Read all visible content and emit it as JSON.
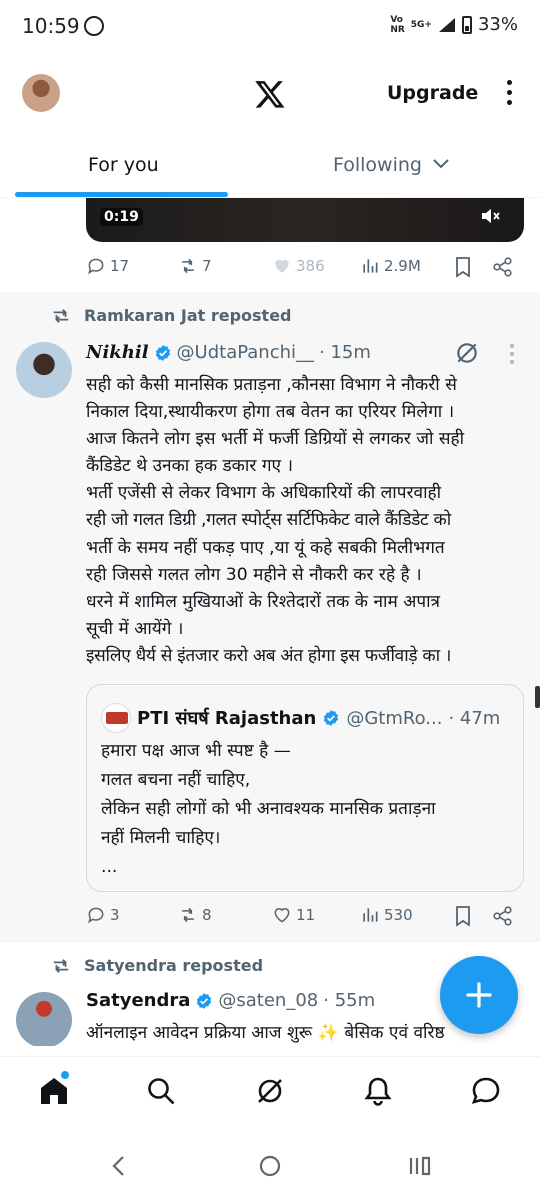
{
  "status_bar": {
    "time": "10:59",
    "network_top": "Vo",
    "network_bottom": "NR",
    "network_type": "5G+",
    "battery": "33%"
  },
  "header": {
    "upgrade_label": "Upgrade"
  },
  "tabs": [
    {
      "label": "For you"
    },
    {
      "label": "Following"
    }
  ],
  "video_post": {
    "duration": "0:19",
    "replies": "17",
    "reposts": "7",
    "likes": "386",
    "views": "2.9M"
  },
  "post1": {
    "repost_label": "Ramkaran Jat reposted",
    "name": "Nikhil",
    "handle": "@UdtaPanchi__",
    "time": "· 15m",
    "text_lines": [
      "सही को कैसी मानसिक प्रताड़ना ,कौनसा विभाग ने नौकरी से",
      "निकाल दिया,स्थायीकरण होगा तब वेतन का एरियर मिलेगा ।",
      "आज कितने लोग इस भर्ती में फर्जी डिग्रियों से लगकर जो सही",
      "कैंडिडेट थे उनका हक डकार गए ।",
      "भर्ती एजेंसी से लेकर विभाग के अधिकारियों की लापरवाही",
      "रही जो गलत डिग्री ,गलत स्पोर्ट्स सर्टिफिकेट वाले कैंडिडेट को",
      "भर्ती के समय नहीं पकड़ पाए ,या यूं कहे सबकी मिलीभगत",
      "रही जिससे गलत लोग 30 महीने से नौकरी कर रहे है ।",
      "धरने में शामिल मुखियाओं के रिश्तेदारों तक के नाम अपात्र",
      "सूची में आयेंगे ।",
      "इसलिए धैर्य से इंतजार करो अब अंत होगा इस फर्जीवाड़े का ।"
    ],
    "quote": {
      "name": "PTI संघर्ष Rajasthan",
      "handle": "@GtmRo...",
      "time": "· 47m",
      "text_lines": [
        "हमारा पक्ष आज भी स्पष्ट है —",
        "गलत बचना नहीं चाहिए,",
        "लेकिन सही लोगों को भी अनावश्यक मानसिक प्रताड़ना",
        "नहीं मिलनी चाहिए।",
        "..."
      ]
    },
    "replies": "3",
    "reposts": "8",
    "likes": "11",
    "views": "530"
  },
  "post2": {
    "repost_label": "Satyendra reposted",
    "name": "Satyendra",
    "handle": "@saten_08",
    "time": "· 55m",
    "text_line": "ऑनलाइन आवेदन प्रक्रिया आज शुरू ✨ बेसिक एवं वरिष्ठ"
  },
  "icons": {
    "fab": "plus-icon",
    "nav": [
      "home-icon",
      "search-icon",
      "grok-icon",
      "bell-icon",
      "messages-icon"
    ],
    "system_nav": [
      "back-icon",
      "home-circle-icon",
      "recents-icon"
    ]
  },
  "colors": {
    "accent": "#1d9bf0",
    "secondary_text": "#536471",
    "primary_text": "#0f1419"
  }
}
